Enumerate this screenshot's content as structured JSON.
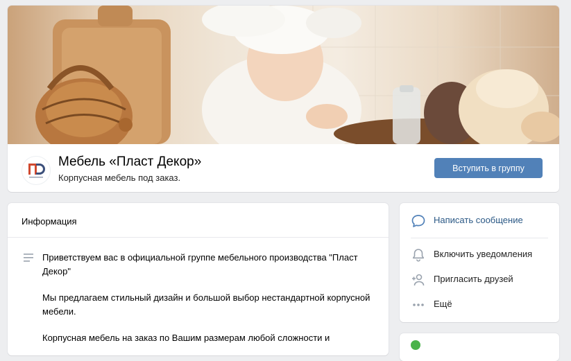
{
  "group": {
    "name": "Мебель «Пласт Декор»",
    "status": "Корпусная мебель под заказ.",
    "join_label": "Вступить в группу",
    "logo_letters": "ПД",
    "logo_subtext": "пласт декор"
  },
  "info": {
    "title": "Информация",
    "paragraphs": [
      "Приветствуем вас в официальной группе мебельного производства \"Пласт Декор\"",
      "Мы предлагаем стильный дизайн и большой выбор нестандартной корпусной мебели.",
      "Корпусная мебель на заказ по Вашим размерам любой сложности и"
    ]
  },
  "actions": {
    "items": [
      {
        "label": "Написать сообщение",
        "icon": "message-icon"
      },
      {
        "label": "Включить уведомления",
        "icon": "bell-icon"
      },
      {
        "label": "Пригласить друзей",
        "icon": "add-user-icon"
      },
      {
        "label": "Ещё",
        "icon": "more-icon"
      }
    ]
  },
  "colors": {
    "accent": "#5181b8",
    "link": "#2a5885",
    "background": "#edeef0"
  }
}
